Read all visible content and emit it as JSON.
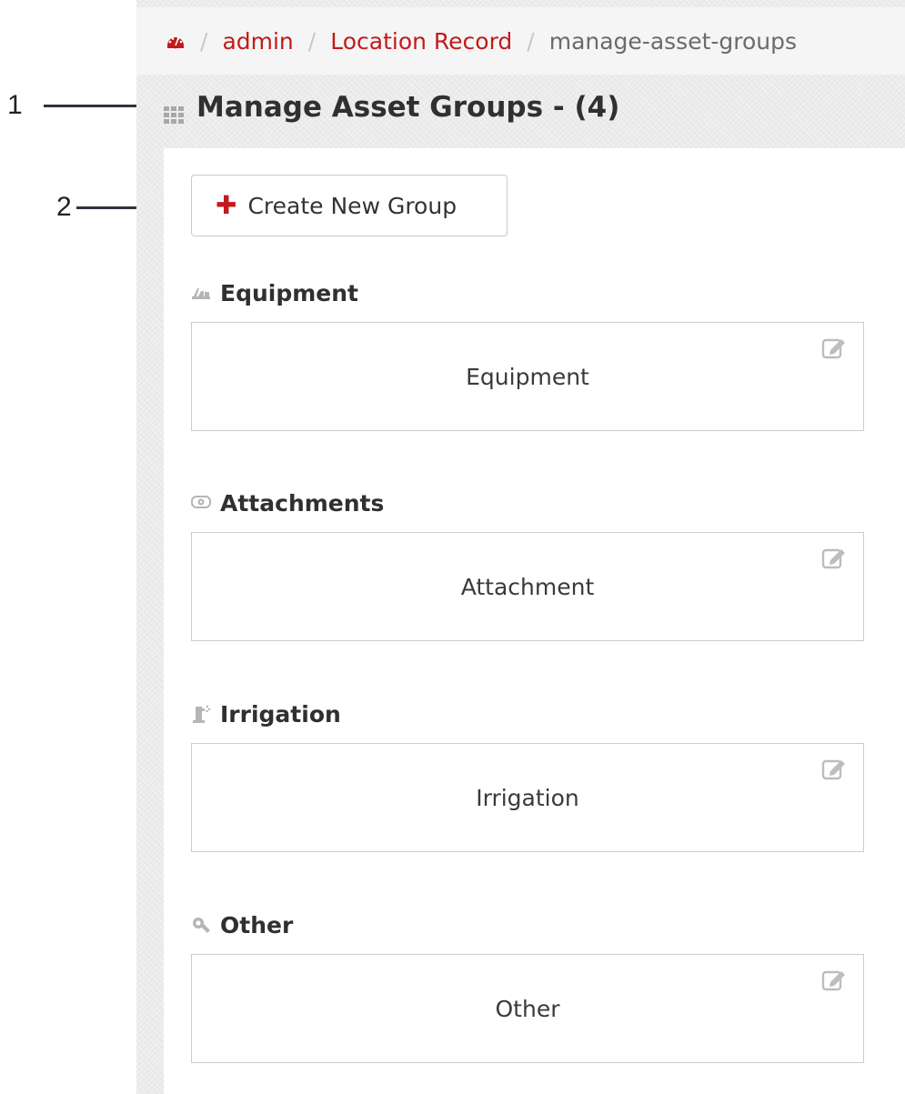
{
  "callouts": [
    "1",
    "2"
  ],
  "breadcrumb": {
    "home_icon": "dashboard-icon",
    "separator": "/",
    "links": [
      "admin",
      "Location Record"
    ],
    "current": "manage-asset-groups"
  },
  "page": {
    "title": "Manage Asset Groups - (4)",
    "title_icon": "grid-icon"
  },
  "toolbar": {
    "create_label": "Create New Group",
    "create_icon": "plus-icon"
  },
  "groups": [
    {
      "header": "Equipment",
      "icon": "equipment-icon",
      "card_label": "Equipment"
    },
    {
      "header": "Attachments",
      "icon": "attachment-icon",
      "card_label": "Attachment"
    },
    {
      "header": "Irrigation",
      "icon": "irrigation-icon",
      "card_label": "Irrigation"
    },
    {
      "header": "Other",
      "icon": "tools-icon",
      "card_label": "Other"
    }
  ],
  "colors": {
    "accent_red": "#c11b1b",
    "text_dark": "#303030",
    "muted": "#6b6b6b",
    "icon_gray": "#b5b5b5"
  }
}
